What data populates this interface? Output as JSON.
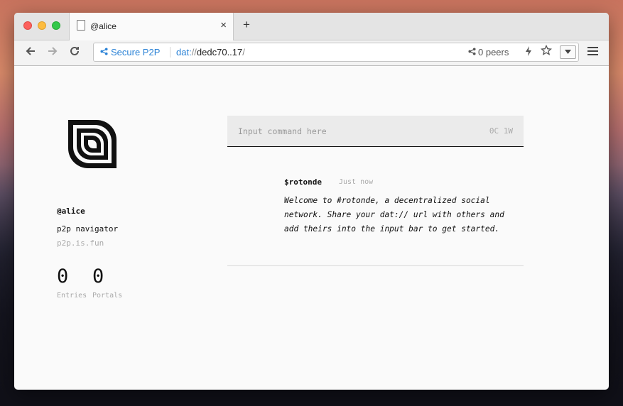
{
  "tab": {
    "title": "@alice",
    "close": "×",
    "new_tab": "+"
  },
  "address": {
    "secure_label": "Secure P2P",
    "protocol": "dat:",
    "slashes": "//",
    "host": "dedc70..17",
    "trail": "/",
    "peers": "0 peers"
  },
  "profile": {
    "name": "@alice",
    "description": "p2p navigator",
    "site": "p2p.is.fun",
    "entries_count": "0",
    "portals_count": "0",
    "entries_label": "Entries",
    "portals_label": "Portals"
  },
  "command": {
    "placeholder": "Input command here",
    "counter": "0C 1W"
  },
  "feed": [
    {
      "author": "$rotonde",
      "time": "Just now",
      "body": "Welcome to #rotonde, a decentralized social network. Share your dat:// url with others and add theirs into the input bar to get started."
    }
  ],
  "icons": {
    "back": "arrow-left-icon",
    "forward": "arrow-right-icon",
    "reload": "reload-icon",
    "share": "share-icon",
    "bolt": "bolt-icon",
    "star": "star-icon",
    "menu": "hamburger-icon"
  },
  "colors": {
    "accent": "#2a82d6"
  }
}
